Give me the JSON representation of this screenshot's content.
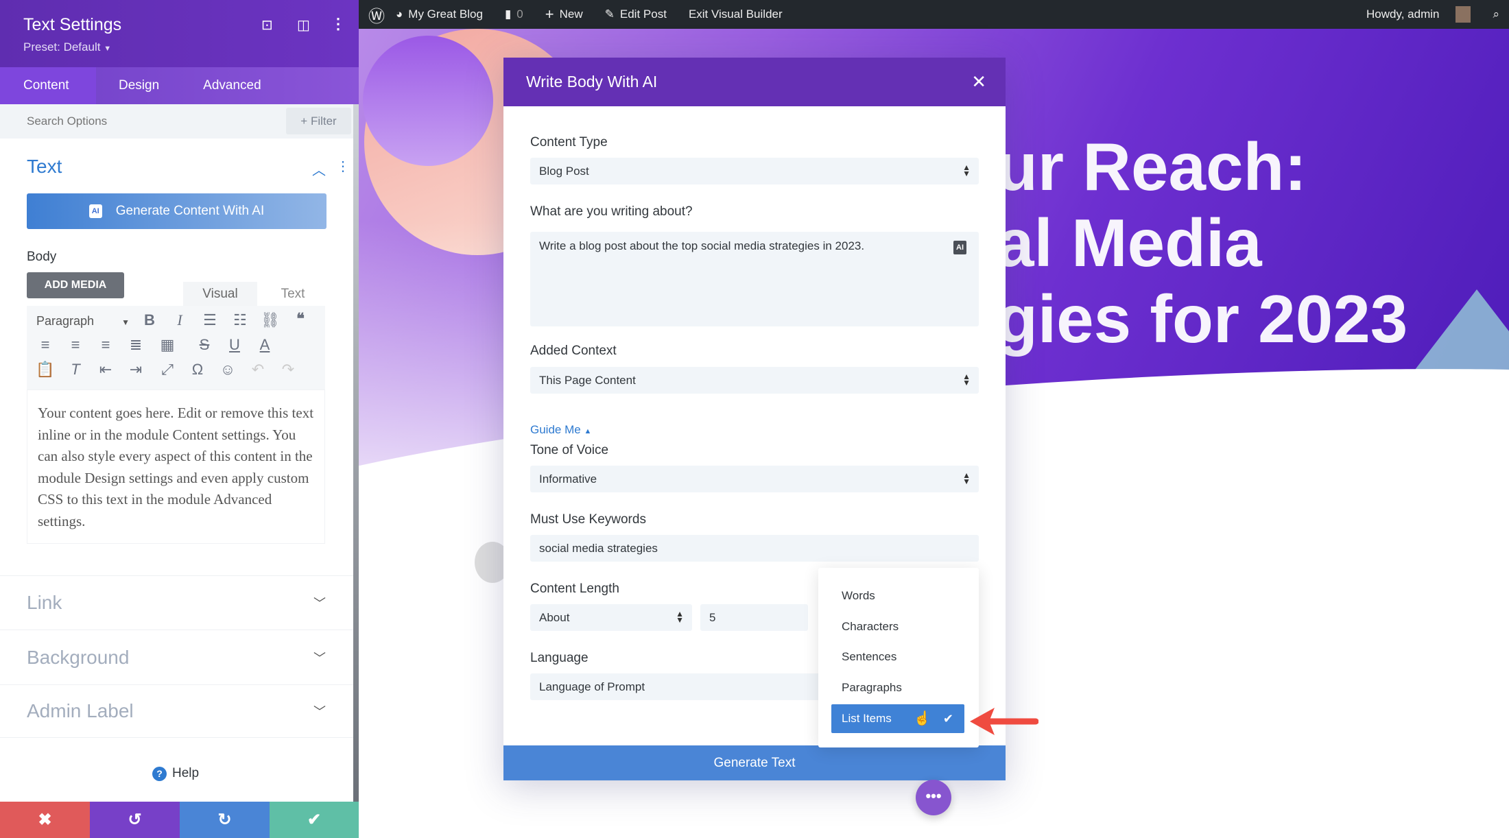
{
  "admin_bar": {
    "site_name": "My Great Blog",
    "comments_count": "0",
    "new_label": "New",
    "edit_post": "Edit Post",
    "exit_builder": "Exit Visual Builder",
    "greeting": "Howdy, admin"
  },
  "hero": {
    "line1": "ur Reach:",
    "line2": "al Media",
    "line3": "gies for 2023"
  },
  "panel": {
    "title": "Text Settings",
    "preset": "Preset: Default",
    "tabs": [
      {
        "label": "Content",
        "active": true
      },
      {
        "label": "Design"
      },
      {
        "label": "Advanced"
      }
    ],
    "search_placeholder": "Search Options",
    "filter_label": "Filter",
    "text_section": {
      "title": "Text",
      "generate_button": "Generate Content With AI",
      "ai_badge": "AI",
      "body_label": "Body",
      "add_media": "ADD MEDIA",
      "editor_tabs": [
        "Visual",
        "Text"
      ],
      "format_select": "Paragraph",
      "content": "Your content goes here. Edit or remove this text inline or in the module Content settings. You can also style every aspect of this content in the module Design settings and even apply custom CSS to this text in the module Advanced settings."
    },
    "sections": [
      "Link",
      "Background",
      "Admin Label"
    ],
    "help": "Help"
  },
  "modal": {
    "title": "Write Body With AI",
    "content_type": {
      "label": "Content Type",
      "value": "Blog Post"
    },
    "topic": {
      "label": "What are you writing about?",
      "value": "Write a blog post about the top social media strategies in 2023.",
      "ai_badge": "AI"
    },
    "added_context": {
      "label": "Added Context",
      "value": "This Page Content"
    },
    "guide_me": "Guide Me",
    "tone": {
      "label": "Tone of Voice",
      "value": "Informative"
    },
    "keywords": {
      "label": "Must Use Keywords",
      "value": "social media strategies"
    },
    "length": {
      "label": "Content Length",
      "qualifier": "About",
      "number": "5",
      "unit_options": [
        "Words",
        "Characters",
        "Sentences",
        "Paragraphs",
        "List Items"
      ],
      "selected_unit": "List Items"
    },
    "language": {
      "label": "Language",
      "value": "Language of Prompt"
    },
    "generate_button": "Generate Text"
  },
  "colors": {
    "purple": "#6430b4",
    "blue": "#4a85d6",
    "red": "#e05a5a",
    "green": "#5fbfa6",
    "arrow": "#ef4b40"
  }
}
